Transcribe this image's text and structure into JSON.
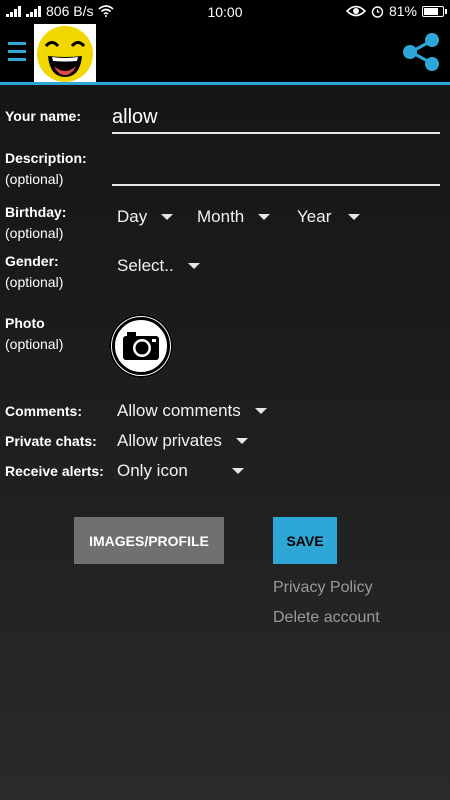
{
  "status_bar": {
    "speed": "806 B/s",
    "time": "10:00",
    "battery": "81%",
    "battery_level": 0.81
  },
  "app_bar": {
    "menu_icon": "hamburger-menu-icon",
    "logo_icon": "laughing-smiley-icon",
    "share_icon": "share-icon",
    "accent_color": "#2fa7d6"
  },
  "form": {
    "name_label": "Your name:",
    "name_value": "allow",
    "description_label": "Description:",
    "description_optional": "(optional)",
    "description_value": "",
    "birthday_label": "Birthday:",
    "birthday_optional": "(optional)",
    "birthday_day": "Day",
    "birthday_month": "Month",
    "birthday_year": "Year",
    "gender_label": "Gender:",
    "gender_optional": "(optional)",
    "gender_value": "Select..",
    "photo_label": "Photo",
    "photo_optional": "(optional)",
    "photo_icon": "camera-icon",
    "comments_label": "Comments:",
    "comments_value": "Allow comments",
    "private_label": "Private chats:",
    "private_value": "Allow privates",
    "alerts_label": "Receive alerts:",
    "alerts_value": "Only icon"
  },
  "actions": {
    "images_profile": "IMAGES/PROFILE",
    "save": "SAVE",
    "privacy_policy": "Privacy Policy",
    "delete_account": "Delete account"
  }
}
